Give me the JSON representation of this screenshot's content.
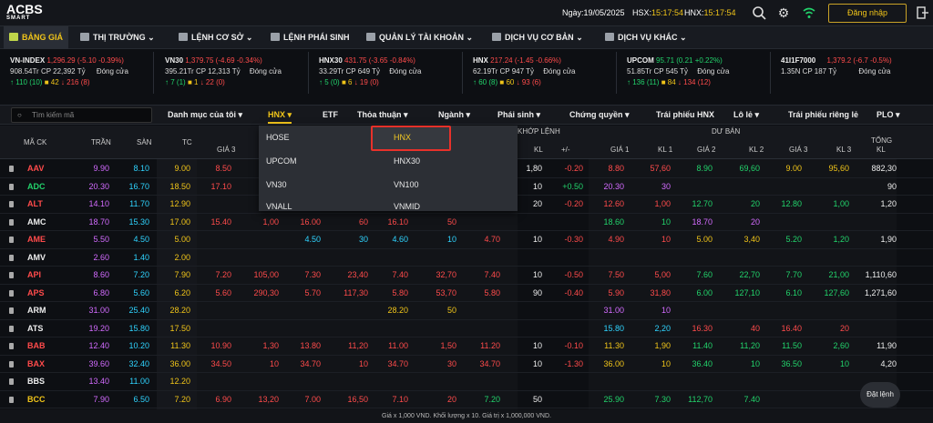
{
  "header": {
    "logo": "ACBS",
    "logo_sub": "SMART",
    "date_label": "Ngày:",
    "date": "19/05/2025",
    "hsx_label": "HSX:",
    "hsx_time": "15:17:54",
    "hnx_label": "HNX:",
    "hnx_time": "15:17:54",
    "login": "Đăng nhập"
  },
  "nav": {
    "items": [
      "BẢNG GIÁ",
      "THỊ TRƯỜNG",
      "LỆNH CƠ SỞ",
      "LỆNH PHÁI SINH",
      "QUẢN LÝ TÀI KHOẢN",
      "DỊCH VỤ CƠ BẢN",
      "DỊCH VỤ KHÁC"
    ]
  },
  "tickers": [
    {
      "name": "VN-INDEX",
      "val": "1,296.29 (-5.10 -0.39%)",
      "vol": "908.54Tr CP",
      "amt": "22,392 Tỷ",
      "status": "Đóng cửa",
      "up": "110",
      "upc": "(10)",
      "ref": "42",
      "down": "216",
      "downc": "(8)"
    },
    {
      "name": "VN30",
      "val": "1,379.75 (-4.69 -0.34%)",
      "vol": "395.21Tr CP",
      "amt": "12,313 Tỷ",
      "status": "Đóng cửa",
      "up": "7",
      "upc": "(1)",
      "ref": "1",
      "down": "22",
      "downc": "(0)"
    },
    {
      "name": "HNX30",
      "val": "431.75 (-3.65 -0.84%)",
      "vol": "33.29Tr CP",
      "amt": "649 Tỷ",
      "status": "Đóng cửa",
      "up": "5",
      "upc": "(0)",
      "ref": "6",
      "down": "19",
      "downc": "(0)"
    },
    {
      "name": "HNX",
      "val": "217.24 (-1.45 -0.66%)",
      "vol": "62.19Tr CP",
      "amt": "947 Tỷ",
      "status": "Đóng cửa",
      "up": "60",
      "upc": "(8)",
      "ref": "60",
      "down": "93",
      "downc": "(6)"
    },
    {
      "name": "UPCOM",
      "val": "95.71 (0.21 +0.22%)",
      "vol": "51.85Tr CP",
      "amt": "545 Tỷ",
      "status": "Đóng cửa",
      "up": "136",
      "upc": "(11)",
      "ref": "84",
      "down": "134",
      "downc": "(12)"
    },
    {
      "name": "41I1F7000",
      "val": "1,379.2 (-6.7 -0.5%)",
      "vol": "1.35N CP",
      "amt": "187 Tỷ",
      "status": "Đóng cửa",
      "up": "",
      "upc": "",
      "ref": "",
      "down": "",
      "downc": ""
    }
  ],
  "filters": {
    "search_placeholder": "Tìm kiếm mã",
    "tabs": [
      "Danh mục của tôi",
      "HNX",
      "ETF",
      "Thỏa thuận",
      "Ngành",
      "Phái sinh",
      "Chứng quyền",
      "Trái phiếu HNX",
      "Lô lẻ",
      "Trái phiếu riêng lẻ",
      "PLO"
    ]
  },
  "dropdown": {
    "options": [
      "HOSE",
      "HNX",
      "UPCOM",
      "HNX30",
      "VN30",
      "VN100",
      "VNALL",
      "VNMID"
    ]
  },
  "columns": {
    "ma": "MÃ CK",
    "tran": "TRẦN",
    "san": "SÀN",
    "tc": "TC",
    "gia3": "GIÁ 3",
    "khop": "KHỚP LỆNH",
    "kl": "KL",
    "pm": "+/-",
    "duban": "DƯ BÁN",
    "gia1": "GIÁ 1",
    "kl1": "KL 1",
    "gia2": "GIÁ 2",
    "kl2": "KL 2",
    "gia3b": "GIÁ 3",
    "kl3": "KL 3",
    "tong": "TỔNG",
    "kl_t": "KL"
  },
  "rows": [
    {
      "sym": "AAV",
      "tran": "9.90",
      "san": "8.10",
      "tc": "9.00",
      "b3": "8.50",
      "bk3": "",
      "b2": "",
      "bk2": "",
      "b1": "",
      "bk1": "",
      "mp": "",
      "mk": "1,80",
      "pm": "-0.20",
      "s1": "8.80",
      "sk1": "57,60",
      "s2": "8.90",
      "sk2": "69,60",
      "s3": "9.00",
      "sk3": "95,60",
      "tot": "882,30"
    },
    {
      "sym": "ADC",
      "tran": "20.30",
      "san": "16.70",
      "tc": "18.50",
      "b3": "17.10",
      "bk3": "",
      "b2": "",
      "bk2": "",
      "b1": "",
      "bk1": "",
      "mp": "",
      "mk": "10",
      "pm": "+0.50",
      "s1": "20.30",
      "sk1": "30",
      "s2": "",
      "sk2": "",
      "s3": "",
      "sk3": "",
      "tot": "90"
    },
    {
      "sym": "ALT",
      "tran": "14.10",
      "san": "11.70",
      "tc": "12.90",
      "b3": "",
      "bk3": "",
      "b2": "",
      "bk2": "",
      "b1": "",
      "bk1": "",
      "mp": "",
      "mk": "20",
      "pm": "-0.20",
      "s1": "12.60",
      "sk1": "1,00",
      "s2": "12.70",
      "sk2": "20",
      "s3": "12.80",
      "sk3": "1,00",
      "tot": "1,20"
    },
    {
      "sym": "AMC",
      "tran": "18.70",
      "san": "15.30",
      "tc": "17.00",
      "b3": "15.40",
      "bk3": "1,00",
      "b2": "16.00",
      "bk2": "60",
      "b1": "16.10",
      "bk1": "50",
      "mp": "",
      "mk": "",
      "pm": "",
      "s1": "18.60",
      "sk1": "10",
      "s2": "18.70",
      "sk2": "20",
      "s3": "",
      "sk3": "",
      "tot": ""
    },
    {
      "sym": "AME",
      "tran": "5.50",
      "san": "4.50",
      "tc": "5.00",
      "b3": "",
      "bk3": "",
      "b2": "4.50",
      "bk2": "30",
      "b1": "4.60",
      "bk1": "10",
      "mp": "4.70",
      "mk": "10",
      "pm": "-0.30",
      "s1": "4.90",
      "sk1": "10",
      "s2": "5.00",
      "sk2": "3,40",
      "s3": "5.20",
      "sk3": "1,20",
      "tot": "1,90"
    },
    {
      "sym": "AMV",
      "tran": "2.60",
      "san": "1.40",
      "tc": "2.00",
      "b3": "",
      "bk3": "",
      "b2": "",
      "bk2": "",
      "b1": "",
      "bk1": "",
      "mp": "",
      "mk": "",
      "pm": "",
      "s1": "",
      "sk1": "",
      "s2": "",
      "sk2": "",
      "s3": "",
      "sk3": "",
      "tot": ""
    },
    {
      "sym": "API",
      "tran": "8.60",
      "san": "7.20",
      "tc": "7.90",
      "b3": "7.20",
      "bk3": "105,00",
      "b2": "7.30",
      "bk2": "23,40",
      "b1": "7.40",
      "bk1": "32,70",
      "mp": "7.40",
      "mk": "10",
      "pm": "-0.50",
      "s1": "7.50",
      "sk1": "5,00",
      "s2": "7.60",
      "sk2": "22,70",
      "s3": "7.70",
      "sk3": "21,00",
      "tot": "1,110,60"
    },
    {
      "sym": "APS",
      "tran": "6.80",
      "san": "5.60",
      "tc": "6.20",
      "b3": "5.60",
      "bk3": "290,30",
      "b2": "5.70",
      "bk2": "117,30",
      "b1": "5.80",
      "bk1": "53,70",
      "mp": "5.80",
      "mk": "90",
      "pm": "-0.40",
      "s1": "5.90",
      "sk1": "31,80",
      "s2": "6.00",
      "sk2": "127,10",
      "s3": "6.10",
      "sk3": "127,60",
      "tot": "1,271,60"
    },
    {
      "sym": "ARM",
      "tran": "31.00",
      "san": "25.40",
      "tc": "28.20",
      "b3": "",
      "bk3": "",
      "b2": "",
      "bk2": "",
      "b1": "28.20",
      "bk1": "50",
      "mp": "",
      "mk": "",
      "pm": "",
      "s1": "31.00",
      "sk1": "10",
      "s2": "",
      "sk2": "",
      "s3": "",
      "sk3": "",
      "tot": ""
    },
    {
      "sym": "ATS",
      "tran": "19.20",
      "san": "15.80",
      "tc": "17.50",
      "b3": "",
      "bk3": "",
      "b2": "",
      "bk2": "",
      "b1": "",
      "bk1": "",
      "mp": "",
      "mk": "",
      "pm": "",
      "s1": "15.80",
      "sk1": "2,20",
      "s2": "16.30",
      "sk2": "40",
      "s3": "16.40",
      "sk3": "20",
      "tot": ""
    },
    {
      "sym": "BAB",
      "tran": "12.40",
      "san": "10.20",
      "tc": "11.30",
      "b3": "10.90",
      "bk3": "1,30",
      "b2": "13.80",
      "bk2": "11,20",
      "b1": "11.00",
      "bk1": "1,50",
      "mp": "11.20",
      "mk": "10",
      "pm": "-0.10",
      "s1": "11.30",
      "sk1": "1,90",
      "s2": "11.40",
      "sk2": "11,20",
      "s3": "11.50",
      "sk3": "2,60",
      "tot": "11,90"
    },
    {
      "sym": "BAX",
      "tran": "39.60",
      "san": "32.40",
      "tc": "36.00",
      "b3": "34.50",
      "bk3": "10",
      "b2": "34.70",
      "bk2": "10",
      "b1": "34.70",
      "bk1": "30",
      "mp": "34.70",
      "mk": "10",
      "pm": "-1.30",
      "s1": "36.00",
      "sk1": "10",
      "s2": "36.40",
      "sk2": "10",
      "s3": "36.50",
      "sk3": "10",
      "tot": "4,20"
    },
    {
      "sym": "BBS",
      "tran": "13.40",
      "san": "11.00",
      "tc": "12.20",
      "b3": "",
      "bk3": "",
      "b2": "",
      "bk2": "",
      "b1": "",
      "bk1": "",
      "mp": "",
      "mk": "",
      "pm": "",
      "s1": "",
      "sk1": "",
      "s2": "",
      "sk2": "",
      "s3": "",
      "sk3": "",
      "tot": ""
    },
    {
      "sym": "BCC",
      "tran": "7.90",
      "san": "6.50",
      "tc": "7.20",
      "b3": "6.90",
      "bk3": "13,20",
      "b2": "7.00",
      "bk2": "16,50",
      "b1": "7.10",
      "bk1": "20",
      "mp": "7.20",
      "mk": "50",
      "pm": "",
      "s1": "25.90",
      "sk1": "7.30",
      "s2": "112,70",
      "sk2": "7.40",
      "s3": "",
      "sk3": "",
      "tot": "35,30"
    }
  ],
  "footer": "Giá x 1,000 VND. Khối lượng x 10. Giá trị x 1,000,000 VND.",
  "chat": "Đặt lệnh"
}
